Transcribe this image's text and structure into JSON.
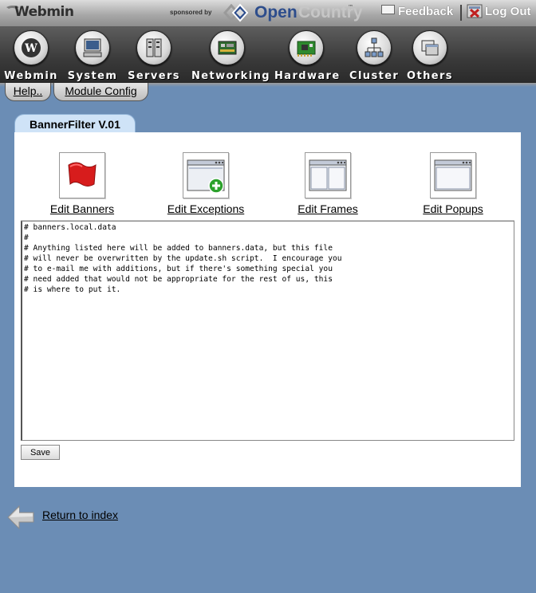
{
  "header": {
    "logo_text": "Webmin",
    "sponsored_by": "sponsored by",
    "sponsor_open": "Open",
    "sponsor_country": "Country",
    "sponsor_tm": "™",
    "feedback_label": "Feedback",
    "logout_label": "Log Out"
  },
  "categories": [
    {
      "label": "Webmin",
      "icon": "webmin-icon"
    },
    {
      "label": "System",
      "icon": "system-icon"
    },
    {
      "label": "Servers",
      "icon": "servers-icon"
    },
    {
      "label": "Networking",
      "icon": "networking-icon"
    },
    {
      "label": "Hardware",
      "icon": "hardware-icon"
    },
    {
      "label": "Cluster",
      "icon": "cluster-icon"
    },
    {
      "label": "Others",
      "icon": "others-icon"
    }
  ],
  "tabs": {
    "help": "Help..",
    "module_config": "Module Config"
  },
  "module": {
    "title": "BannerFilter V.01"
  },
  "actions": [
    {
      "label": "Edit Banners",
      "icon": "red-flag-icon"
    },
    {
      "label": "Edit Exceptions",
      "icon": "window-add-icon"
    },
    {
      "label": "Edit Frames",
      "icon": "window-frames-icon"
    },
    {
      "label": "Edit Popups",
      "icon": "window-popup-icon"
    }
  ],
  "editor": {
    "content": "# banners.local.data\n#\n# Anything listed here will be added to banners.data, but this file\n# will never be overwritten by the update.sh script.  I encourage you\n# to e-mail me with additions, but if there's something special you\n# need added that would not be appropriate for the rest of us, this\n# is where to put it.",
    "save_label": "Save"
  },
  "footer": {
    "return_label": "Return to index"
  },
  "colors": {
    "page_background": "#6b8db5",
    "module_tab": "#cfe3f7",
    "sponsor_blue": "#2d4d8c"
  }
}
